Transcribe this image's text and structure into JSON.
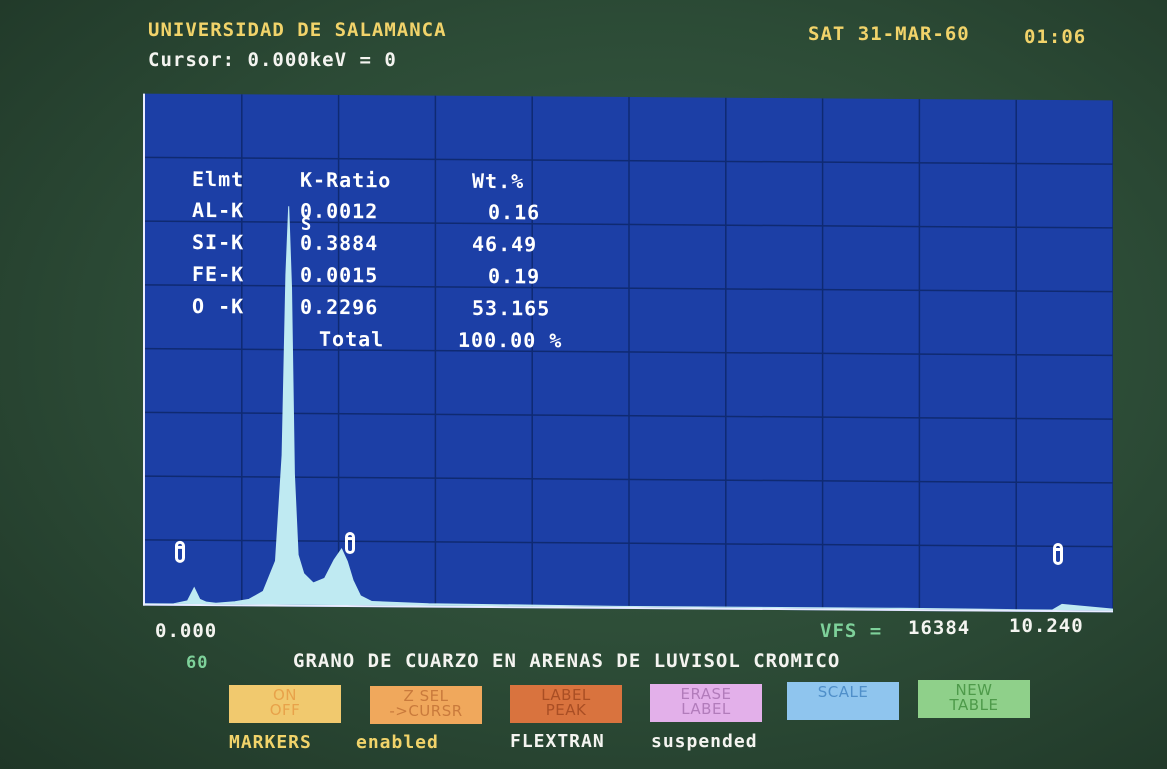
{
  "header": {
    "institution": "UNIVERSIDAD DE SALAMANCA",
    "date": "SAT 31-MAR-60",
    "time": "01:06",
    "cursor": "Cursor: 0.000keV = 0"
  },
  "results_table": {
    "headers": [
      "Elmt",
      "K-Ratio",
      "Wt.%"
    ],
    "rows": [
      {
        "element": "AL-K",
        "k_ratio": "0.0012",
        "wt": "0.16"
      },
      {
        "element": "SI-K",
        "k_ratio": "0.3884",
        "wt": "46.49"
      },
      {
        "element": "FE-K",
        "k_ratio": "0.0015",
        "wt": "0.19"
      },
      {
        "element": "O -K",
        "k_ratio": "0.2296",
        "wt": "53.165"
      }
    ],
    "total_label": "Total",
    "total_value": "100.00 %"
  },
  "peak_label": "S",
  "axis": {
    "x_start": "0.000",
    "x_end": "10.240",
    "vfs_label": "VFS =",
    "vfs_value": "16384",
    "page_number": "60"
  },
  "sample_title": "GRANO DE CUARZO EN ARENAS DE LUVISOL CROMICO",
  "buttons": [
    {
      "line1": "ON",
      "line2": "OFF",
      "color": "#f1c96e",
      "text_color": "#e8a24a"
    },
    {
      "line1": "Z SEL",
      "line2": "->CURSR",
      "color": "#f0a85c",
      "text_color": "#c97a3c"
    },
    {
      "line1": "LABEL",
      "line2": "PEAK",
      "color": "#d9733e",
      "text_color": "#a94e24"
    },
    {
      "line1": "ERASE",
      "line2": "LABEL",
      "color": "#e3b0ea",
      "text_color": "#b27cbb"
    },
    {
      "line1": "SCALE",
      "line2": "",
      "color": "#8fc5ee",
      "text_color": "#4f8fc9"
    },
    {
      "line1": "NEW",
      "line2": "TABLE",
      "color": "#8fd08a",
      "text_color": "#4e9a4a"
    }
  ],
  "status": {
    "markers_label": "MARKERS",
    "markers_state": "enabled",
    "flextran_label": "FLEXTRAN",
    "flextran_state": "suspended"
  },
  "chart_data": {
    "type": "area",
    "x_unit": "keV",
    "xlim": [
      0,
      10.24
    ],
    "ylim": [
      0,
      16384
    ],
    "color": "#bfeaf2",
    "x": [
      0.0,
      0.3,
      0.45,
      0.52,
      0.58,
      0.65,
      0.75,
      0.95,
      1.1,
      1.25,
      1.38,
      1.45,
      1.49,
      1.52,
      1.55,
      1.58,
      1.62,
      1.68,
      1.78,
      1.9,
      2.0,
      2.08,
      2.14,
      2.2,
      2.28,
      2.4,
      3.0,
      5.0,
      8.0,
      9.6,
      9.7,
      10.24
    ],
    "y": [
      0,
      0,
      100,
      520,
      150,
      60,
      30,
      80,
      160,
      420,
      1400,
      4800,
      10600,
      12800,
      10200,
      4200,
      1600,
      1000,
      700,
      850,
      1450,
      1800,
      1400,
      800,
      300,
      120,
      60,
      20,
      20,
      0,
      180,
      40
    ],
    "markers_keV": [
      0.0,
      2.1,
      9.6
    ]
  }
}
